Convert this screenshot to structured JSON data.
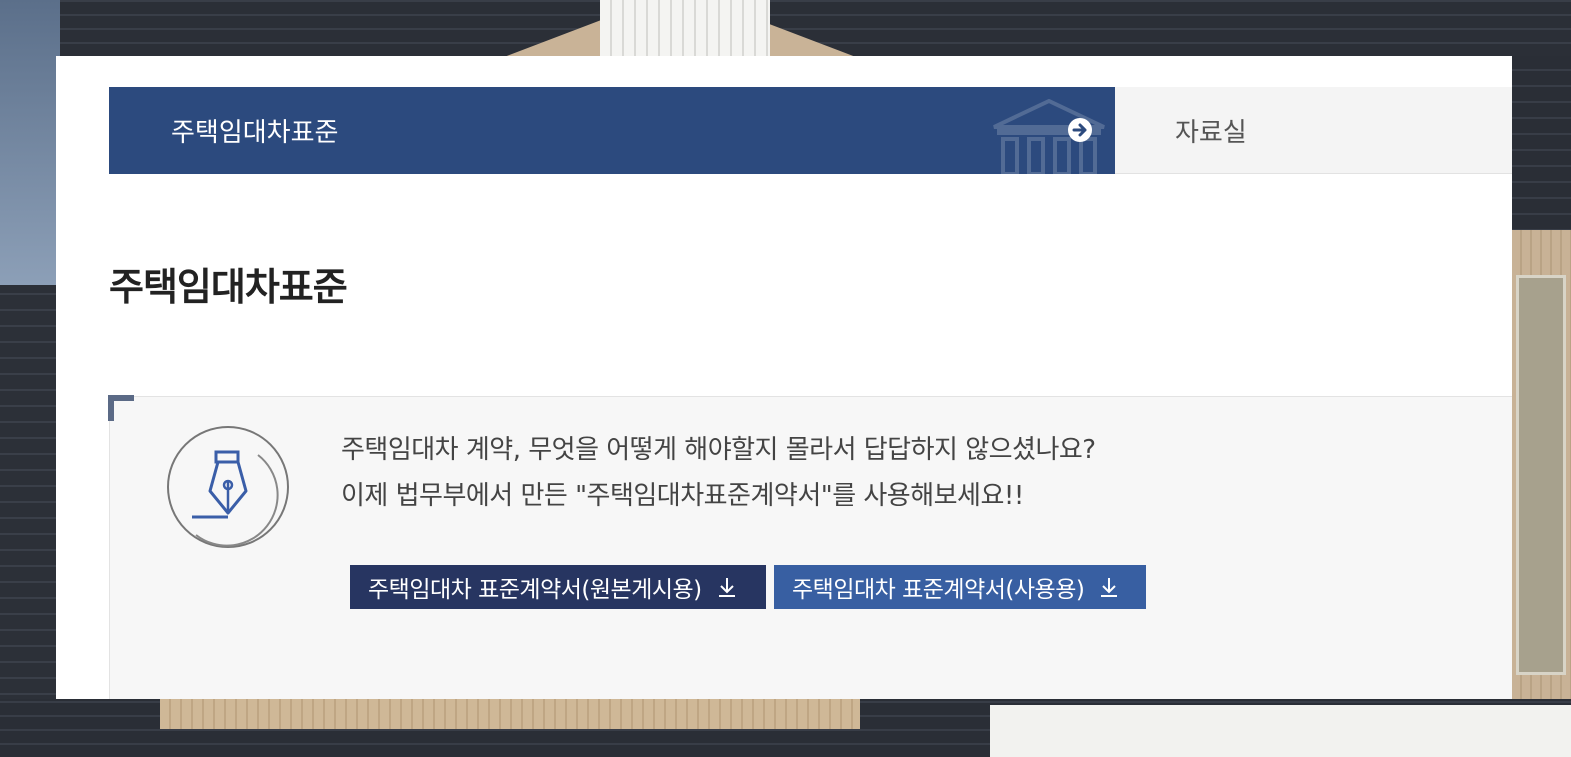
{
  "tabs": {
    "active": "주택임대차표준",
    "other": "자료실"
  },
  "page": {
    "title": "주택임대차표준"
  },
  "info": {
    "line1": "주택임대차 계약, 무엇을 어떻게 해야할지 몰라서 답답하지 않으셨나요?",
    "line2": "이제 법무부에서 만든 \"주택임대차표준계약서\"를 사용해보세요!!"
  },
  "buttons": {
    "original": "주택임대차 표준계약서(원본게시용)",
    "usage": "주택임대차 표준계약서(사용용)"
  },
  "icons": {
    "tab_arrow": "arrow-right-circle-icon",
    "pen": "fountain-pen-icon",
    "download": "download-icon"
  },
  "colors": {
    "tab_active": "#2c4a7e",
    "button_dark": "#273561",
    "button_blue": "#385fa2"
  }
}
